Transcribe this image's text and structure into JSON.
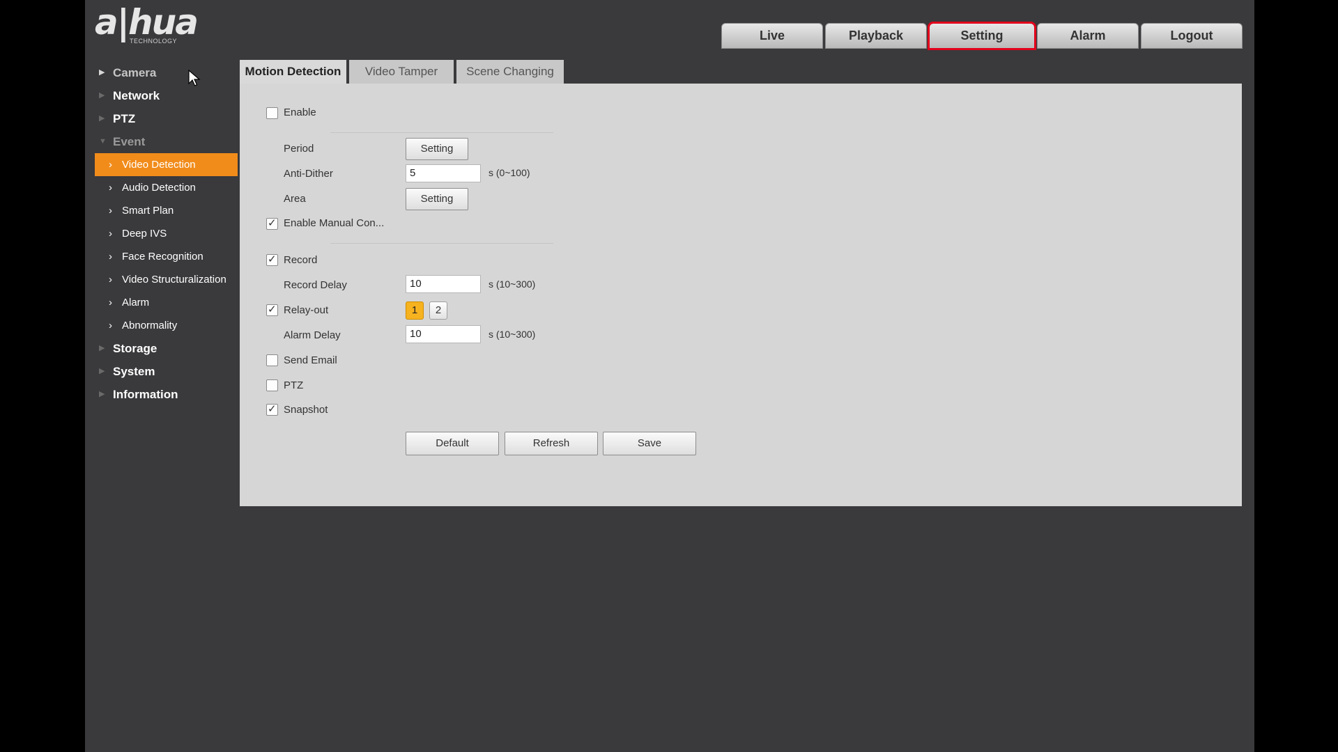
{
  "brand": {
    "logo_text": "a|hua",
    "logo_sub": "TECHNOLOGY"
  },
  "topnav": [
    {
      "label": "Live"
    },
    {
      "label": "Playback"
    },
    {
      "label": "Setting"
    },
    {
      "label": "Alarm"
    },
    {
      "label": "Logout"
    }
  ],
  "active_topnav": "Setting",
  "sidebar": {
    "camera": "Camera",
    "network": "Network",
    "ptz": "PTZ",
    "event": "Event",
    "event_items": [
      "Video Detection",
      "Audio Detection",
      "Smart Plan",
      "Deep IVS",
      "Face Recognition",
      "Video Structuralization",
      "Alarm",
      "Abnormality"
    ],
    "storage": "Storage",
    "system": "System",
    "information": "Information"
  },
  "tabs": [
    {
      "label": "Motion Detection"
    },
    {
      "label": "Video Tamper"
    },
    {
      "label": "Scene Changing"
    }
  ],
  "form": {
    "enable": {
      "label": "Enable",
      "checked": false
    },
    "period": {
      "label": "Period",
      "button": "Setting"
    },
    "anti_dither": {
      "label": "Anti-Dither",
      "value": "5",
      "unit": "s (0~100)"
    },
    "area": {
      "label": "Area",
      "button": "Setting"
    },
    "manual_control": {
      "label": "Enable Manual Con...",
      "checked": true
    },
    "record": {
      "label": "Record",
      "checked": true
    },
    "record_delay": {
      "label": "Record Delay",
      "value": "10",
      "unit": "s (10~300)"
    },
    "relay_out": {
      "label": "Relay-out",
      "checked": true,
      "options": [
        "1",
        "2"
      ],
      "selected": "1"
    },
    "alarm_delay": {
      "label": "Alarm Delay",
      "value": "10",
      "unit": "s (10~300)"
    },
    "send_email": {
      "label": "Send Email",
      "checked": false
    },
    "ptz": {
      "label": "PTZ",
      "checked": false
    },
    "snapshot": {
      "label": "Snapshot",
      "checked": true
    }
  },
  "actions": {
    "default": "Default",
    "refresh": "Refresh",
    "save": "Save"
  },
  "colors": {
    "accent": "#f18c1b",
    "highlight_box": "#e3001b",
    "relay_selected": "#f7b21f"
  }
}
